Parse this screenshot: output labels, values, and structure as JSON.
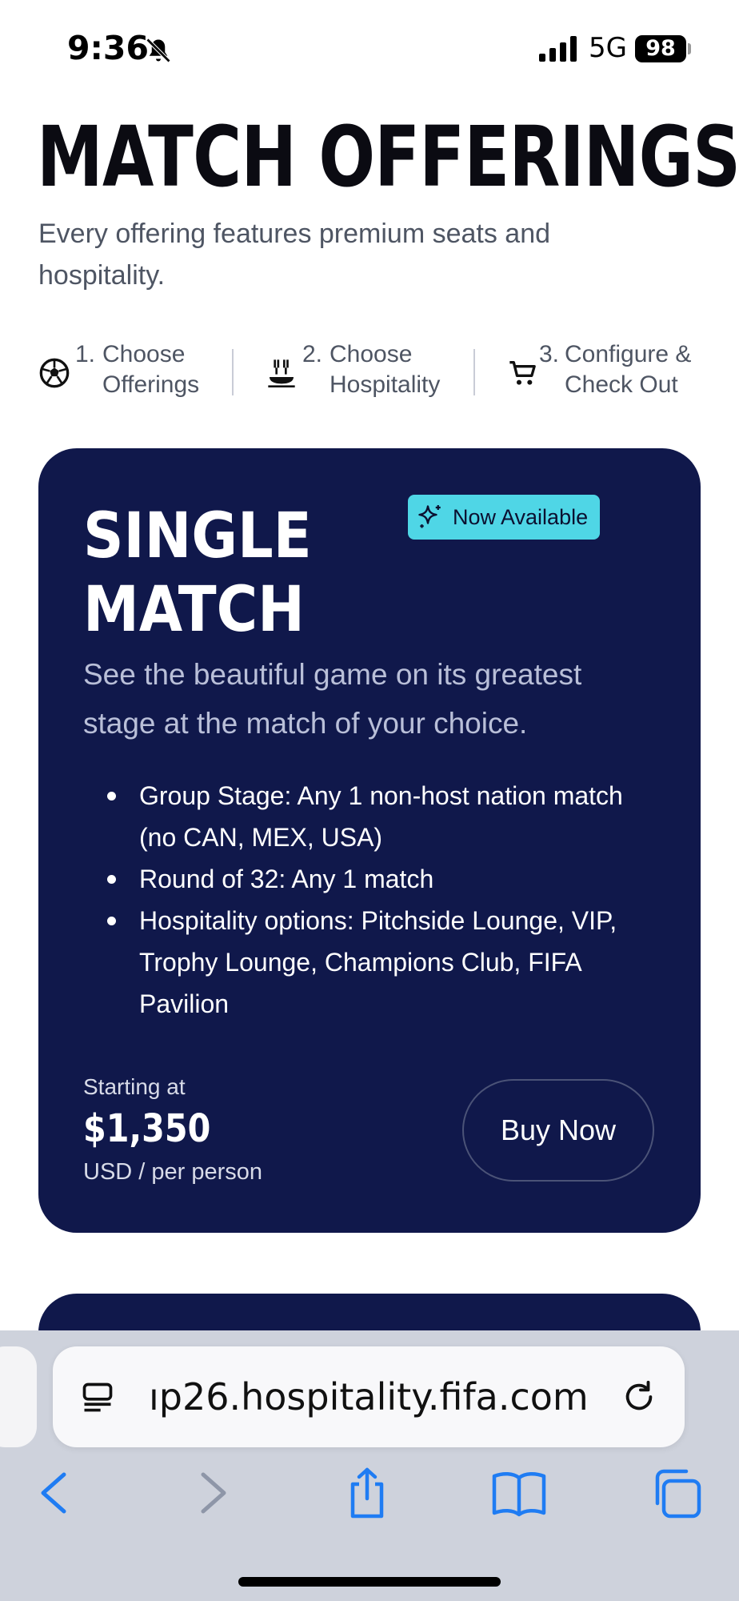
{
  "status_bar": {
    "time": "9:36",
    "network": "5G",
    "battery": "98",
    "icons": [
      "bell-slash-icon",
      "signal-icon"
    ]
  },
  "page": {
    "title": "MATCH OFFERINGS",
    "subtitle": "Every offering features premium seats and hospitality."
  },
  "steps": [
    {
      "num": "1.",
      "label": "Choose Offerings",
      "icon": "soccer-ball-icon"
    },
    {
      "num": "2.",
      "label": "Choose Hospitality",
      "icon": "dining-icon"
    },
    {
      "num": "3.",
      "label": "Configure & Check Out",
      "icon": "cart-icon"
    }
  ],
  "offer": {
    "title": "SINGLE MATCH",
    "badge": "Now Available",
    "badge_icon": "sparkles-icon",
    "description": "See the beautiful game on its greatest stage at the match of your choice.",
    "features": [
      "Group Stage: Any 1 non-host nation match (no CAN, MEX, USA)",
      "Round of 32: Any 1 match",
      "Hospitality options: Pitchside Lounge, VIP, Trophy Lounge, Champions Club, FIFA Pavilion"
    ],
    "price_caption": "Starting at",
    "price": "$1,350",
    "price_unit": "USD / per person",
    "cta": "Buy Now"
  },
  "browser": {
    "url": "ıp26.hospitality.fifa.com",
    "toolbar": [
      "back-icon",
      "forward-icon",
      "share-icon",
      "bookmarks-icon",
      "tabs-icon"
    ]
  },
  "colors": {
    "card_bg": "#10184b",
    "badge_bg": "#4fd6e6",
    "browser_accent": "#1f7cf3"
  }
}
